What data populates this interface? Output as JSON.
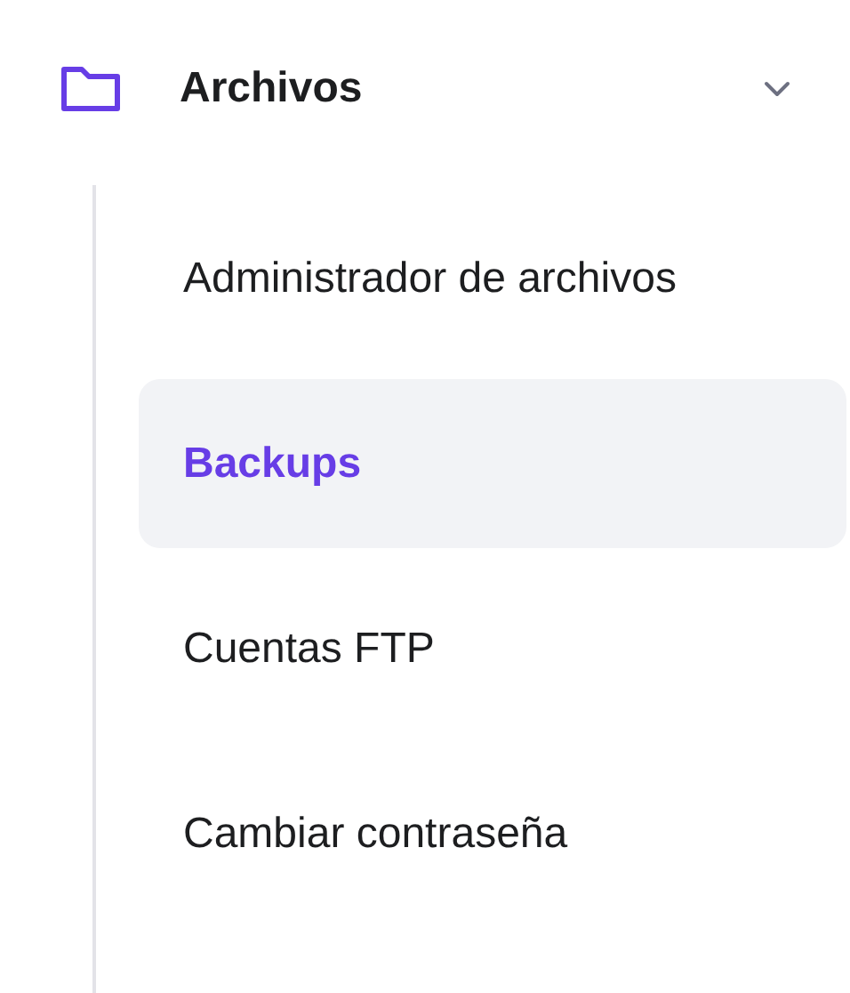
{
  "group": {
    "title": "Archivos",
    "expanded": true,
    "items": [
      {
        "label": "Administrador de archivos",
        "selected": false
      },
      {
        "label": "Backups",
        "selected": true
      },
      {
        "label": "Cuentas FTP",
        "selected": false
      },
      {
        "label": "Cambiar contraseña",
        "selected": false
      }
    ]
  }
}
